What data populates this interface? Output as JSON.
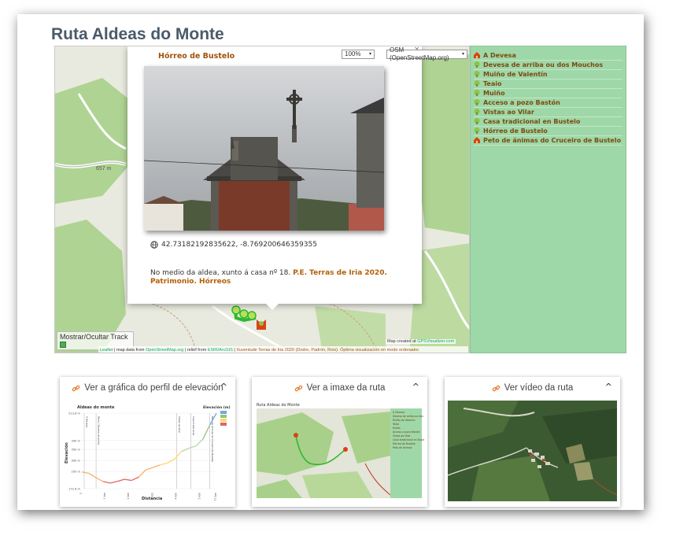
{
  "page": {
    "title": "Ruta Aldeas do Monte"
  },
  "map": {
    "zoom_value": "100%",
    "basemap_value": "OSM (OpenStreetMap.org)",
    "close_symbol": "×",
    "elevation_label": "657 m",
    "track_toggle_label": "Mostrar/Ocultar Track",
    "attribution": {
      "leaflet": "Leaflet",
      "map_data_from": "map data from",
      "osm": "OpenStreetMap.org",
      "relief_from": "relief from",
      "esri": "ESRI/ArcGIS",
      "xuventude": "Xuventude Terras de Iria 2020 (Dodro, Padrón, Rois). Óptima visualización en modo ordenador.",
      "map_created_at": "Map created at",
      "gpsvisualizer": "GPSVisualizer.com"
    },
    "colors": {
      "forest": "#a9d08b",
      "land": "#e8eadf",
      "track": "#2eb82e",
      "marker": "#d84315"
    }
  },
  "popup": {
    "title": "Hórreo de Bustelo",
    "coordinates": "42.73182192835622, -8.769200646359355",
    "description_text": "No medio da aldea, xunto á casa nº 18. ",
    "description_link": "P.E. Terras de Iria 2020. Patrimonio. Hórreos"
  },
  "sidebar": {
    "items": [
      {
        "label": "A Devesa",
        "icon": "house-icon"
      },
      {
        "label": "Devesa de arriba ou dos Mouchos",
        "icon": "tree-icon"
      },
      {
        "label": "Muiño de Valentín",
        "icon": "tree-icon"
      },
      {
        "label": "Teaio",
        "icon": "tree-icon"
      },
      {
        "label": "Muiño",
        "icon": "tree-icon"
      },
      {
        "label": "Acceso a pozo Bastón",
        "icon": "tree-icon"
      },
      {
        "label": "Vistas ao Vilar",
        "icon": "tree-icon"
      },
      {
        "label": "Casa tradicional en Bustelo",
        "icon": "tree-icon"
      },
      {
        "label": "Hórreo de Bustelo",
        "icon": "tree-icon"
      },
      {
        "label": "Peto de ánimas do Cruceiro de Bustelo",
        "icon": "house-icon"
      }
    ]
  },
  "cards": [
    {
      "title": "Ver a gráfica do perfil de elevación",
      "caret": "^"
    },
    {
      "title": "Ver a imaxe da ruta",
      "caret": "^"
    },
    {
      "title": "Ver vídeo da ruta",
      "caret": "^"
    }
  ],
  "elevation_chart": {
    "title": "Aldeas do monte",
    "legend_title": "Elevación (m)",
    "ylabel": "Elevación",
    "xlabel": "Distancia",
    "y_ticks": [
      "513.6 m",
      "390 m",
      "350 m",
      "300 m",
      "250 m",
      "172.6 m"
    ],
    "x_ticks": [
      "0",
      "1 km",
      "2 km",
      "3 km",
      "4 km",
      "5 km",
      "5.677 km"
    ],
    "waypoint_labels": [
      "A Devesa",
      "Teaio / Devesa de arriba",
      "Vistas ao Vilar",
      "Casa tradicional",
      "Peto de ánimas do Cruceiro de Bustelo"
    ]
  },
  "chart_data": {
    "type": "line",
    "title": "Aldeas do monte",
    "xlabel": "Distancia",
    "ylabel": "Elevación",
    "ylim": [
      172.6,
      513.6
    ],
    "x": [
      0,
      0.3,
      0.6,
      0.9,
      1.2,
      1.5,
      1.8,
      2.1,
      2.4,
      2.7,
      3.0,
      3.3,
      3.6,
      3.9,
      4.2,
      4.5,
      4.8,
      5.1,
      5.4,
      5.677
    ],
    "y": [
      248,
      242,
      222,
      205,
      198,
      206,
      215,
      210,
      225,
      258,
      268,
      280,
      288,
      305,
      340,
      355,
      365,
      395,
      460,
      513.6
    ]
  },
  "route_image": {
    "title": "Ruta Aldeas do Monte",
    "legend_items": [
      "A Devesa",
      "Devesa de arriba ou dos Mouchos",
      "Muiño de Valentín",
      "Teaio",
      "Muiño",
      "Acceso a pozo Bastón",
      "Vistas ao Vilar",
      "Casa tradicional en Bustelo",
      "Hórreo de Bustelo",
      "Peto de ánimas"
    ]
  }
}
